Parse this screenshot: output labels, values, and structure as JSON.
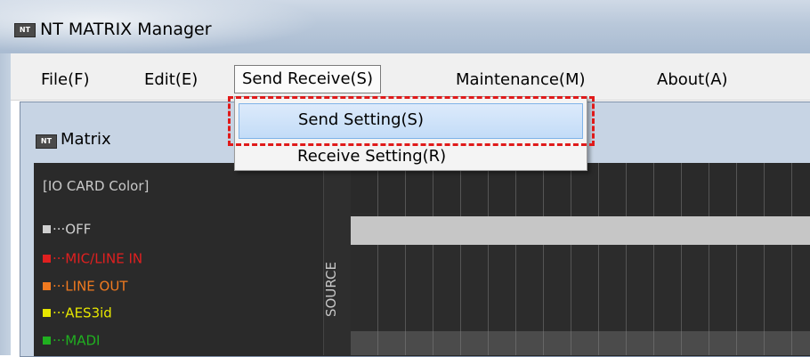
{
  "window": {
    "title": "NT MATRIX Manager",
    "icon": "NT"
  },
  "menubar": {
    "items": [
      {
        "label": "File(F)"
      },
      {
        "label": "Edit(E)"
      },
      {
        "label": "Send Receive(S)"
      },
      {
        "label": "Maintenance(M)"
      },
      {
        "label": "About(A)"
      }
    ]
  },
  "dropdown": {
    "items": [
      {
        "label": "Send Setting(S)",
        "highlighted": true
      },
      {
        "label": "Receive Setting(R)"
      }
    ],
    "highlight_border_color": "#e01a1a"
  },
  "matrix_window": {
    "title": "Matrix",
    "icon": "NT",
    "legend_title": "[IO CARD Color]",
    "legend": [
      {
        "label": "···OFF",
        "color": "#cfcfcf"
      },
      {
        "label": "···MIC/LINE IN",
        "color": "#e02020"
      },
      {
        "label": "···LINE OUT",
        "color": "#f07a20"
      },
      {
        "label": "···AES3id",
        "color": "#e6e600"
      },
      {
        "label": "···MADI",
        "color": "#20b020"
      }
    ],
    "source_label": "SOURCE"
  }
}
